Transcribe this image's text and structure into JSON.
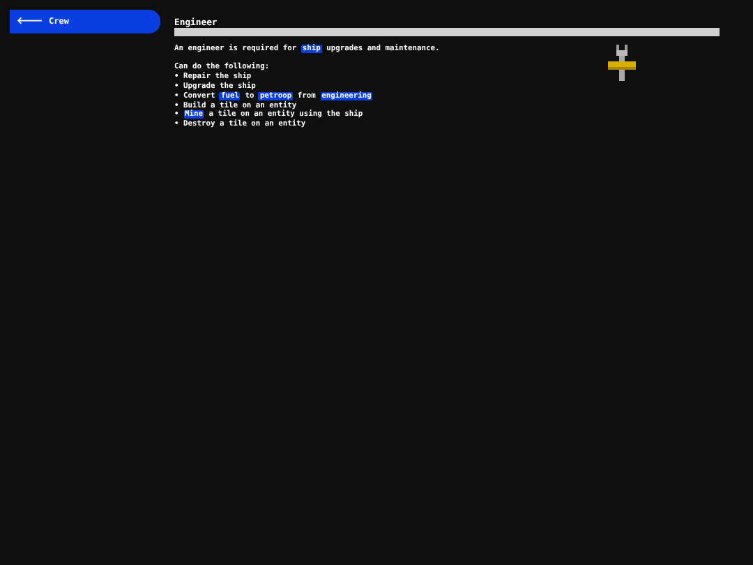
{
  "sidebar": {
    "back_button": {
      "icon": "🡐",
      "label": "Crew"
    }
  },
  "title": "Engineer",
  "intro": [
    {
      "text": "An engineer is required for ",
      "highlight": false
    },
    {
      "text": "ship",
      "highlight": true
    },
    {
      "text": " upgrades and maintenance.",
      "highlight": false
    }
  ],
  "abilities_heading": "Can do the following:",
  "abilities": [
    [
      {
        "text": "Repair the ship",
        "highlight": false
      }
    ],
    [
      {
        "text": "Upgrade the ship",
        "highlight": false
      }
    ],
    [
      {
        "text": "Convert ",
        "highlight": false
      },
      {
        "text": "fuel",
        "highlight": true
      },
      {
        "text": " to ",
        "highlight": false
      },
      {
        "text": "petroop",
        "highlight": true
      },
      {
        "text": " from ",
        "highlight": false
      },
      {
        "text": "engineering",
        "highlight": true
      }
    ],
    [
      {
        "text": "Build a tile on an entity",
        "highlight": false
      }
    ],
    [
      {
        "text": "Mine",
        "highlight": true
      },
      {
        "text": " a tile on an entity using the ship",
        "highlight": false
      }
    ],
    [
      {
        "text": "Destroy a tile on an entity",
        "highlight": false
      }
    ]
  ],
  "bullet": "•"
}
